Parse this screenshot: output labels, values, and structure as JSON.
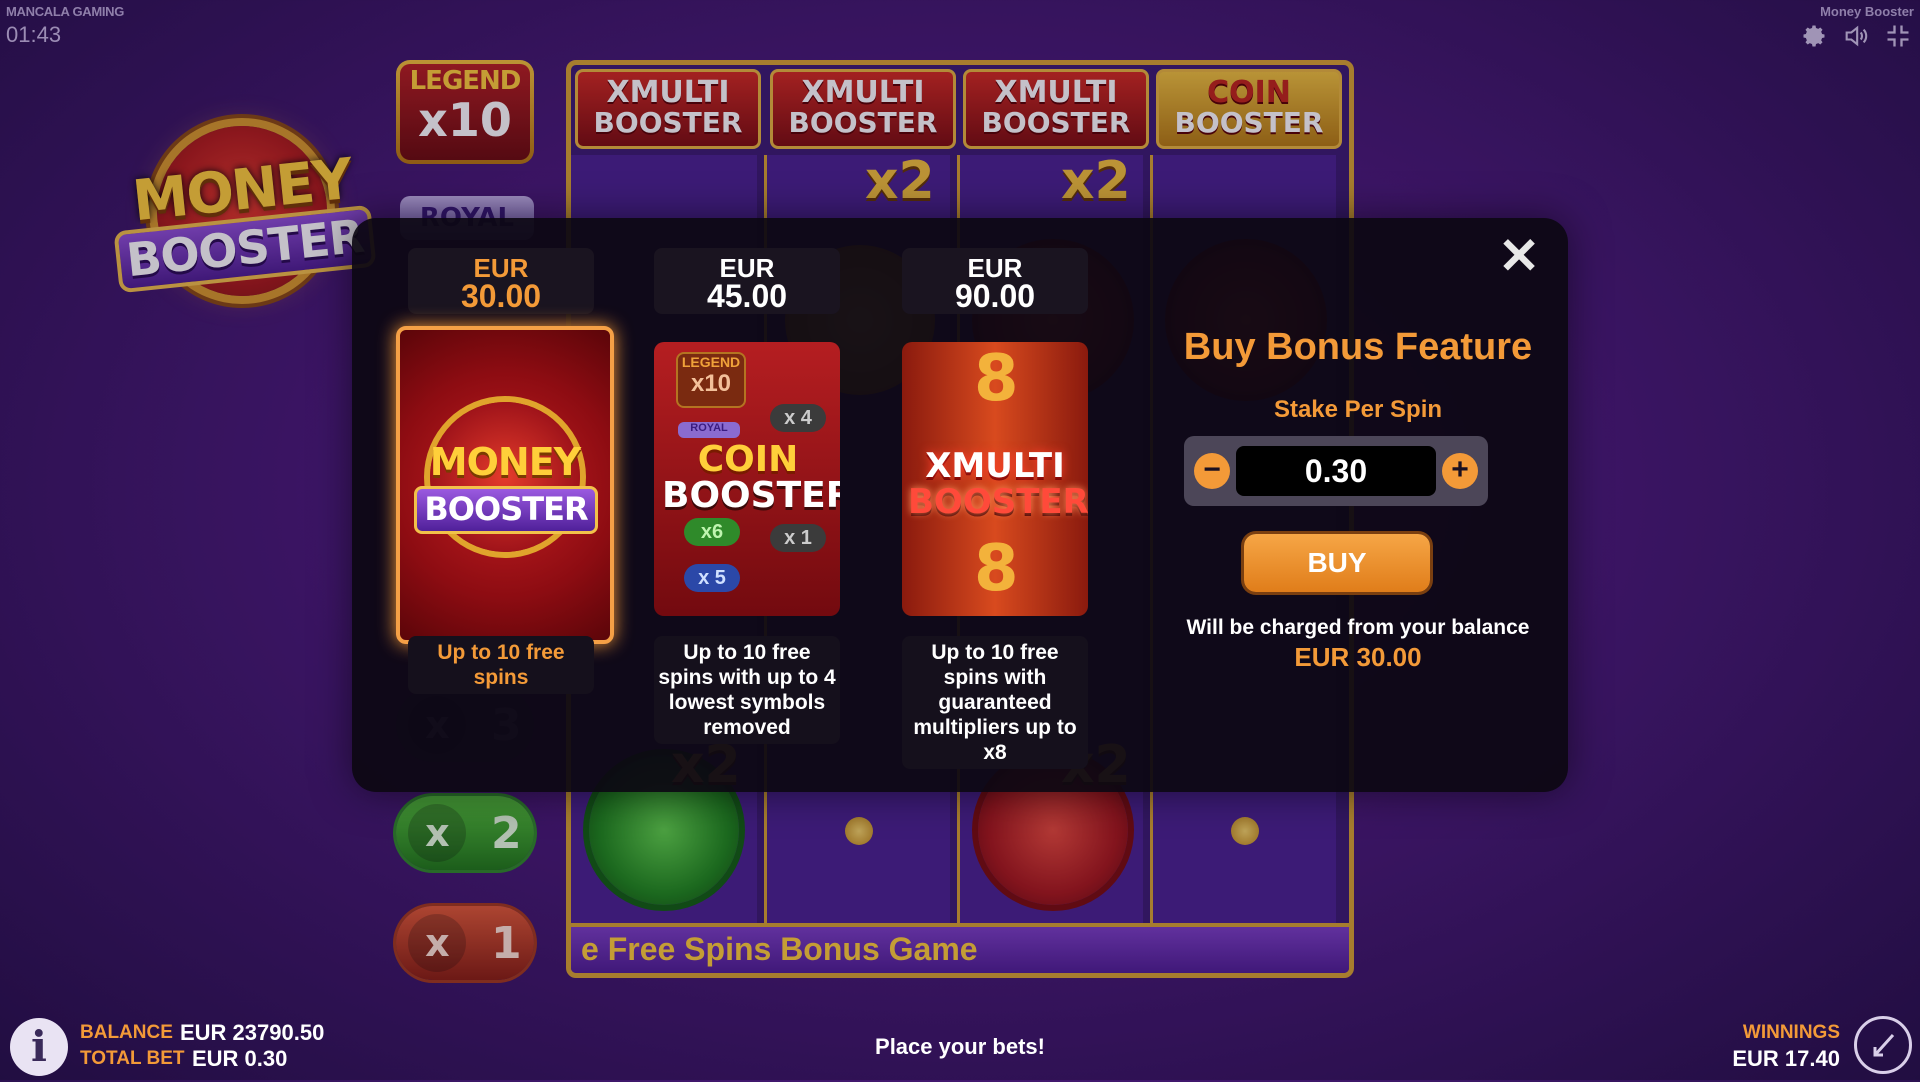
{
  "header": {
    "studio": "MANCALA GAMING",
    "clock": "01:43",
    "game_title": "Money Booster",
    "icons": [
      "gear-icon",
      "speaker-icon",
      "fullscreen-exit-icon"
    ]
  },
  "logo": {
    "line1": "MONEY",
    "line2": "BOOSTER"
  },
  "side_multipliers": {
    "legend_label": "LEGEND",
    "legend_value": "x10",
    "royal_label": "ROYAL",
    "pills": [
      {
        "x": "x",
        "n": "3"
      },
      {
        "x": "x",
        "n": "2"
      },
      {
        "x": "x",
        "n": "1"
      }
    ]
  },
  "reels": {
    "headers": [
      {
        "t1": "XMULTI",
        "t2": "BOOSTER"
      },
      {
        "t1": "XMULTI",
        "t2": "BOOSTER"
      },
      {
        "t1": "XMULTI",
        "t2": "BOOSTER"
      },
      {
        "t1": "COIN",
        "t2": "BOOSTER"
      }
    ],
    "tags": [
      "x2",
      "x2",
      "x2",
      "x2"
    ],
    "banner": "e  Free Spins Bonus Game"
  },
  "modal": {
    "close_label": "✕",
    "options": [
      {
        "currency": "EUR",
        "price": "30.00",
        "description": "Up to 10 free spins",
        "art": {
          "line1": "MONEY",
          "line2": "BOOSTER"
        }
      },
      {
        "currency": "EUR",
        "price": "45.00",
        "description": "Up to 10 free spins with up to 4 lowest symbols removed",
        "art": {
          "legend": "LEGEND",
          "legend_val": "x10",
          "royal": "ROYAL",
          "line1": "COIN",
          "line2": "BOOSTER",
          "p1": "x 4",
          "p2": "x6",
          "p3": "x 1",
          "p4": "x 5"
        }
      },
      {
        "currency": "EUR",
        "price": "90.00",
        "description": "Up to 10 free spins with guaranteed multipliers up to x8",
        "art": {
          "eight": "8",
          "line1": "XMULTI",
          "line2": "BOOSTER"
        }
      }
    ],
    "title": "Buy Bonus Feature",
    "stake_label": "Stake Per Spin",
    "stake_value": "0.30",
    "minus_label": "−",
    "plus_label": "+",
    "buy_label": "BUY",
    "charge_text": "Will be charged from your balance",
    "charge_amount": "EUR 30.00"
  },
  "footer": {
    "info_label": "i",
    "balance_label": "BALANCE",
    "balance_value": "EUR 23790.50",
    "total_bet_label": "TOTAL BET",
    "total_bet_value": "EUR 0.30",
    "status": "Place your bets!",
    "winnings_label": "WINNINGS",
    "winnings_value": "EUR 17.40"
  }
}
